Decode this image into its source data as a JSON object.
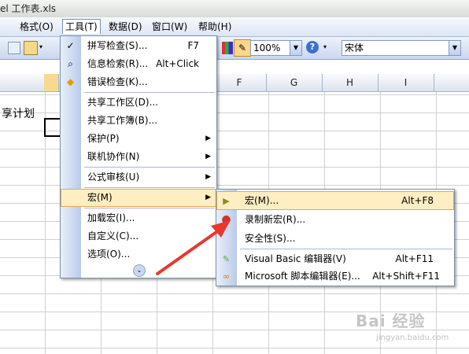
{
  "window": {
    "title": "el 工作表.xls"
  },
  "menubar": {
    "items": [
      {
        "label": "格式(O)"
      },
      {
        "label": "工具(T)"
      },
      {
        "label": "数据(D)"
      },
      {
        "label": "窗口(W)"
      },
      {
        "label": "帮助(H)"
      }
    ]
  },
  "toolbar": {
    "zoom": "100%",
    "font": "宋体"
  },
  "sheet": {
    "columns": [
      "F",
      "G",
      "H",
      "I"
    ],
    "cell_text": "享计划"
  },
  "tools_menu": {
    "items": [
      {
        "label": "拼写检查(S)...",
        "shortcut": "F7",
        "icon": "spellcheck-icon"
      },
      {
        "label": "信息检索(R)...",
        "shortcut": "Alt+Click",
        "icon": "research-icon"
      },
      {
        "label": "错误检查(K)...",
        "shortcut": "",
        "icon": "error-check-icon"
      },
      {
        "label": "共享工作区(D)...",
        "shortcut": ""
      },
      {
        "label": "共享工作簿(B)...",
        "shortcut": ""
      },
      {
        "label": "保护(P)",
        "submenu": true
      },
      {
        "label": "联机协作(N)",
        "submenu": true
      },
      {
        "label": "公式审核(U)",
        "submenu": true
      },
      {
        "label": "宏(M)",
        "submenu": true
      },
      {
        "label": "加载宏(I)...",
        "shortcut": ""
      },
      {
        "label": "自定义(C)...",
        "shortcut": ""
      },
      {
        "label": "选项(O)...",
        "shortcut": ""
      }
    ],
    "expand_icon": "double-chevron-down-icon"
  },
  "macro_menu": {
    "items": [
      {
        "label": "宏(M)...",
        "shortcut": "Alt+F8",
        "icon": "play-icon"
      },
      {
        "label": "录制新宏(R)...",
        "shortcut": "",
        "icon": "record-icon"
      },
      {
        "label": "安全性(S)...",
        "shortcut": ""
      },
      {
        "label": "Visual Basic 编辑器(V)",
        "shortcut": "Alt+F11",
        "icon": "vb-editor-icon"
      },
      {
        "label": "Microsoft 脚本编辑器(E)...",
        "shortcut": "Alt+Shift+F11",
        "icon": "script-editor-icon"
      }
    ]
  },
  "watermark": {
    "text": "Bai 经验",
    "sub": "jingyan.baidu.com"
  },
  "colors": {
    "highlight": "#ffeec2",
    "arrow": "#e8392f"
  }
}
